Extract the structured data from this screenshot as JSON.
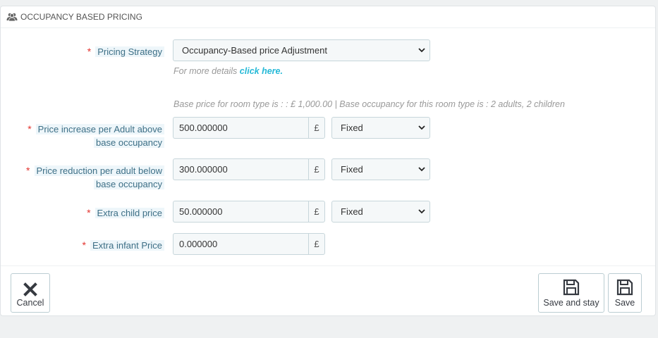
{
  "panel": {
    "title": "OCCUPANCY BASED PRICING",
    "icon": "users-icon"
  },
  "form": {
    "strategy_label": "Pricing Strategy",
    "strategy_value": "Occupancy-Based price Adjustment",
    "more_details_text": "For more details",
    "more_details_link": "click here.",
    "base_info": "Base price for room type is : : £ 1,000.00 | Base occupancy for this room type is : 2 adults, 2 children",
    "currency": "£",
    "adult_increase_label_1": "Price increase per Adult above",
    "adult_increase_label_2": "base occupancy",
    "adult_increase_value": "500.000000",
    "adult_increase_type": "Fixed",
    "adult_reduction_label_1": "Price reduction per adult below",
    "adult_reduction_label_2": "base occupancy",
    "adult_reduction_value": "300.000000",
    "adult_reduction_type": "Fixed",
    "child_label": "Extra child price",
    "child_value": "50.000000",
    "child_type": "Fixed",
    "infant_label": "Extra infant Price",
    "infant_value": "0.000000"
  },
  "footer": {
    "cancel_label": "Cancel",
    "save_stay_label": "Save and stay",
    "save_label": "Save"
  }
}
